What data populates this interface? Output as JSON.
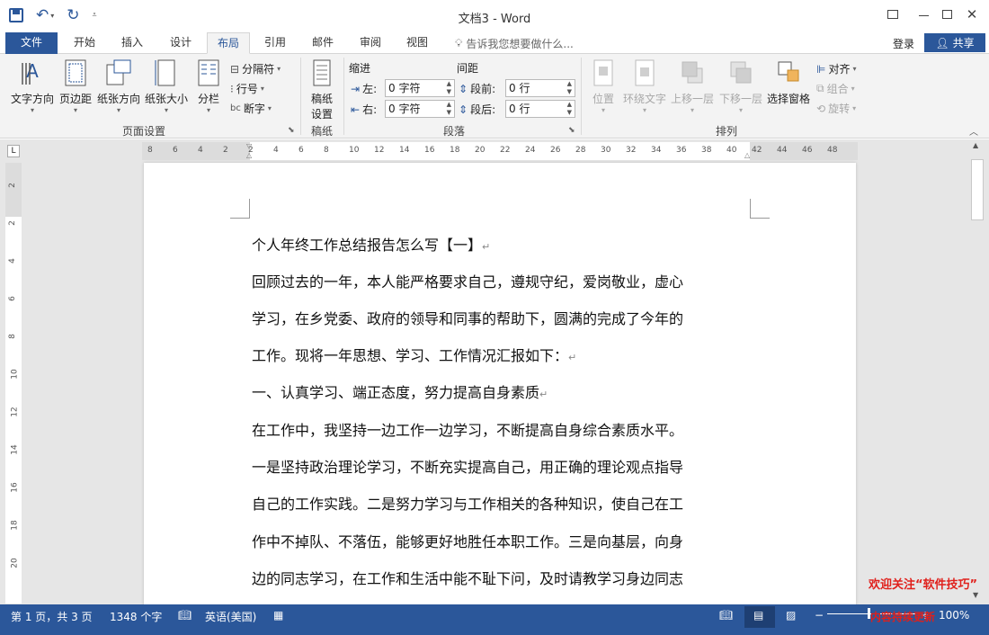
{
  "window": {
    "title": "文档3 - Word"
  },
  "tabs": [
    {
      "label": "文件"
    },
    {
      "label": "开始"
    },
    {
      "label": "插入"
    },
    {
      "label": "设计"
    },
    {
      "label": "布局"
    },
    {
      "label": "引用"
    },
    {
      "label": "邮件"
    },
    {
      "label": "审阅"
    },
    {
      "label": "视图"
    }
  ],
  "tellme": {
    "placeholder": "告诉我您想要做什么..."
  },
  "account": {
    "login": "登录",
    "share": "共享"
  },
  "ribbon": {
    "page_setup": {
      "label": "页面设置",
      "text_direction": "文字方向",
      "margins": "页边距",
      "orientation": "纸张方向",
      "size": "纸张大小",
      "columns": "分栏",
      "breaks": "分隔符",
      "line_numbers": "行号",
      "hyphenation": "断字"
    },
    "draft": {
      "label": "稿纸",
      "draft_setup_1": "稿纸",
      "draft_setup_2": "设置"
    },
    "paragraph": {
      "label": "段落",
      "indent_header": "缩进",
      "spacing_header": "间距",
      "left_label": "左:",
      "right_label": "右:",
      "before_label": "段前:",
      "after_label": "段后:",
      "left_value": "0 字符",
      "right_value": "0 字符",
      "before_value": "0 行",
      "after_value": "0 行"
    },
    "arrange": {
      "label": "排列",
      "position": "位置",
      "wrap_text": "环绕文字",
      "bring_forward": "上移一层",
      "send_backward": "下移一层",
      "selection_pane": "选择窗格",
      "align": "对齐",
      "group": "组合",
      "rotate": "旋转"
    }
  },
  "ruler": {
    "h_ticks": [
      "8",
      "6",
      "4",
      "2",
      "2",
      "4",
      "6",
      "8",
      "10",
      "12",
      "14",
      "16",
      "18",
      "20",
      "22",
      "24",
      "26",
      "28",
      "30",
      "32",
      "34",
      "36",
      "38",
      "40",
      "42",
      "44",
      "46",
      "48"
    ],
    "v_ticks": [
      "2",
      "2",
      "4",
      "6",
      "8",
      "10",
      "12",
      "14",
      "16",
      "18",
      "20"
    ]
  },
  "document": {
    "lines": [
      "个人年终工作总结报告怎么写【一】",
      "回顾过去的一年，本人能严格要求自己，遵规守纪，爱岗敬业，虚心",
      "学习，在乡党委、政府的领导和同事的帮助下，圆满的完成了今年的",
      "工作。现将一年思想、学习、工作情况汇报如下：",
      "一、认真学习、端正态度，努力提高自身素质",
      "在工作中，我坚持一边工作一边学习，不断提高自身综合素质水平。",
      "一是坚持政治理论学习，不断充实提高自己，用正确的理论观点指导",
      "自己的工作实践。二是努力学习与工作相关的各种知识，使自己在工",
      "作中不掉队、不落伍，能够更好地胜任本职工作。三是向基层，向身",
      "边的同志学习，在工作和生活中能不耻下问，及时请教学习身边同志"
    ]
  },
  "watermark": {
    "line1": "欢迎关注“软件技巧”",
    "line2": "内容持续更新"
  },
  "status": {
    "page": "第 1 页，共 3 页",
    "words": "1348 个字",
    "language": "英语(美国)",
    "zoom": "100%"
  },
  "colors": {
    "accent": "#2b579a",
    "ribbon_bg": "#f3f3f3",
    "watermark": "#e0201b"
  }
}
